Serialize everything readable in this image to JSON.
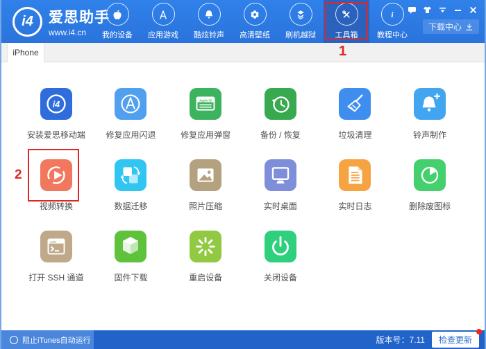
{
  "brand": {
    "logo_text": "i4",
    "title": "爱思助手",
    "url": "www.i4.cn",
    "bar_color": "#2d7ae3"
  },
  "nav": {
    "items": [
      {
        "label": "我的设备",
        "selected": false
      },
      {
        "label": "应用游戏",
        "selected": false
      },
      {
        "label": "酷炫铃声",
        "selected": false
      },
      {
        "label": "高清壁纸",
        "selected": false
      },
      {
        "label": "刷机越狱",
        "selected": false
      },
      {
        "label": "工具箱",
        "selected": true
      },
      {
        "label": "教程中心",
        "selected": false
      }
    ]
  },
  "download_center": {
    "label": "下载中心"
  },
  "tabs": {
    "active": "iPhone"
  },
  "annotations": {
    "toolbox_step": "1",
    "video_step": "2",
    "color": "#e12626"
  },
  "tools": {
    "items": [
      {
        "label": "安装爱思移动端",
        "color": "#2e6ddb"
      },
      {
        "label": "修复应用闪退",
        "color": "#51a0ef"
      },
      {
        "label": "修复应用弹窗",
        "color": "#3db35f"
      },
      {
        "label": "备份 / 恢复",
        "color": "#38a94e"
      },
      {
        "label": "垃圾清理",
        "color": "#3f8def"
      },
      {
        "label": "铃声制作",
        "color": "#41a5f0"
      },
      {
        "label": "视频转换",
        "color": "#f1785e"
      },
      {
        "label": "数据迁移",
        "color": "#31c6f2"
      },
      {
        "label": "照片压缩",
        "color": "#b4a17f"
      },
      {
        "label": "实时桌面",
        "color": "#7e8ed9"
      },
      {
        "label": "实时日志",
        "color": "#f6a342"
      },
      {
        "label": "删除废图标",
        "color": "#44d06d"
      },
      {
        "label": "打开 SSH 通道",
        "color": "#bfa98a"
      },
      {
        "label": "固件下载",
        "color": "#5ec23d"
      },
      {
        "label": "重启设备",
        "color": "#92c943"
      },
      {
        "label": "关闭设备",
        "color": "#2ed07d"
      }
    ]
  },
  "footer": {
    "checkbox_label": "阻止iTunes自动运行",
    "version_label": "版本号：7.11",
    "update_button": "检查更新"
  }
}
